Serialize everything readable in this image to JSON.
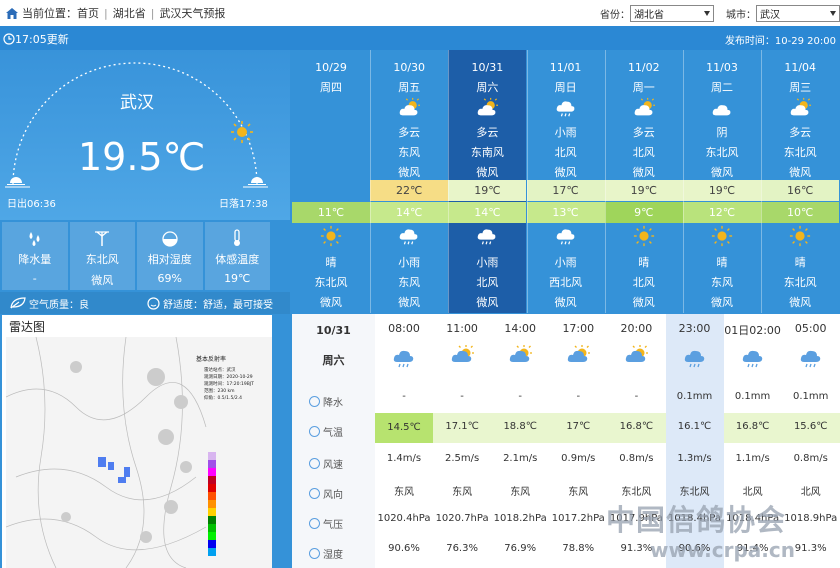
{
  "breadcrumb": {
    "label": "当前位置：",
    "items": [
      "首页",
      "湖北省",
      "武汉天气预报"
    ]
  },
  "selectors": {
    "province_label": "省份：",
    "province_value": "湖北省",
    "city_label": "城市：",
    "city_value": "武汉"
  },
  "update_text": "17:05更新",
  "publish_time": "发布时间：10-29 20:00",
  "current": {
    "city": "武汉",
    "temp": "19.5℃",
    "sunrise": "日出06:36",
    "sunset": "日落17:38"
  },
  "stats": [
    {
      "icon": "rain-drops-icon",
      "label": "降水量",
      "value": "-"
    },
    {
      "icon": "wind-turbine-icon",
      "label": "东北风",
      "value": "微风"
    },
    {
      "icon": "humidity-icon",
      "label": "相对湿度",
      "value": "69%"
    },
    {
      "icon": "thermometer-icon",
      "label": "体感温度",
      "value": "19℃"
    }
  ],
  "air": {
    "quality": "空气质量：良",
    "comfort": "舒适度：舒适，最可接受"
  },
  "radar": {
    "title": "雷达图",
    "header": "基本反射率",
    "station": "雷达站点：武汉",
    "obs_time": "观测日期：2020-10-29",
    "scan_time": "观测时间：17:20:19BJT",
    "range": "范围：230 km",
    "elev": "仰角：0.5/1.5/2.4"
  },
  "days": [
    {
      "date": "10/29",
      "week": "周四",
      "day_icon": "",
      "day_cond": "",
      "day_wind": "",
      "day_level": "",
      "hi": "",
      "lo": "11℃",
      "night_icon": "sun-icon",
      "night_cond": "晴",
      "night_wind": "东北风",
      "night_level": "微风",
      "hi_color": "",
      "lo_color": "#a8d86a"
    },
    {
      "date": "10/30",
      "week": "周五",
      "day_icon": "partly-cloudy-icon",
      "day_cond": "多云",
      "day_wind": "东风",
      "day_level": "微风",
      "hi": "22℃",
      "lo": "14℃",
      "night_icon": "cloud-rain-icon",
      "night_cond": "小雨",
      "night_wind": "东风",
      "night_level": "微风",
      "hi_color": "#f6dd86",
      "lo_color": "#c6e98c"
    },
    {
      "date": "10/31",
      "week": "周六",
      "day_icon": "partly-cloudy-icon",
      "day_cond": "多云",
      "day_wind": "东南风",
      "day_level": "微风",
      "hi": "19℃",
      "lo": "14℃",
      "night_icon": "cloud-rain-icon",
      "night_cond": "小雨",
      "night_wind": "北风",
      "night_level": "微风",
      "hi_color": "#e8f5c9",
      "lo_color": "#c6e98c"
    },
    {
      "date": "11/01",
      "week": "周日",
      "day_icon": "cloud-rain-icon",
      "day_cond": "小雨",
      "day_wind": "北风",
      "day_level": "微风",
      "hi": "17℃",
      "lo": "13℃",
      "night_icon": "cloud-rain-icon",
      "night_cond": "小雨",
      "night_wind": "西北风",
      "night_level": "微风",
      "hi_color": "#e3f3c4",
      "lo_color": "#c6e98c"
    },
    {
      "date": "11/02",
      "week": "周一",
      "day_icon": "partly-cloudy-icon",
      "day_cond": "多云",
      "day_wind": "北风",
      "day_level": "微风",
      "hi": "19℃",
      "lo": "9℃",
      "night_icon": "sun-icon",
      "night_cond": "晴",
      "night_wind": "北风",
      "night_level": "微风",
      "hi_color": "#e8f5c9",
      "lo_color": "#9fd55b"
    },
    {
      "date": "11/03",
      "week": "周二",
      "day_icon": "cloud-icon",
      "day_cond": "阴",
      "day_wind": "东北风",
      "day_level": "微风",
      "hi": "19℃",
      "lo": "12℃",
      "night_icon": "sun-icon",
      "night_cond": "晴",
      "night_wind": "东风",
      "night_level": "微风",
      "hi_color": "#e8f5c9",
      "lo_color": "#b9e37c"
    },
    {
      "date": "11/04",
      "week": "周三",
      "day_icon": "partly-cloudy-icon",
      "day_cond": "多云",
      "day_wind": "东北风",
      "day_level": "微风",
      "hi": "16℃",
      "lo": "10℃",
      "night_icon": "sun-icon",
      "night_cond": "晴",
      "night_wind": "东北风",
      "night_level": "微风",
      "hi_color": "#e3f3c4",
      "lo_color": "#a8d86a"
    }
  ],
  "hourly": {
    "date": "10/31",
    "week": "周六",
    "labels": [
      {
        "icon": "precip-icon",
        "text": "降水"
      },
      {
        "icon": "thermometer-icon",
        "text": "气温"
      },
      {
        "icon": "wind-speed-icon",
        "text": "风速"
      },
      {
        "icon": "wind-direction-icon",
        "text": "风向"
      },
      {
        "icon": "pressure-icon",
        "text": "气压"
      },
      {
        "icon": "humidity-icon",
        "text": "湿度"
      }
    ],
    "cols": [
      {
        "time": "08:00",
        "icon": "cloud-rain-icon",
        "rain": "-",
        "temp": "14.5℃",
        "speed": "1.4m/s",
        "dir": "东风",
        "pres": "1020.4hPa",
        "hum": "90.6%",
        "temp_hl": true
      },
      {
        "time": "11:00",
        "icon": "partly-cloudy-icon",
        "rain": "-",
        "temp": "17.1℃",
        "speed": "2.5m/s",
        "dir": "东风",
        "pres": "1020.7hPa",
        "hum": "76.3%",
        "temp_hl": false
      },
      {
        "time": "14:00",
        "icon": "partly-cloudy-icon",
        "rain": "-",
        "temp": "18.8℃",
        "speed": "2.1m/s",
        "dir": "东风",
        "pres": "1018.2hPa",
        "hum": "76.9%",
        "temp_hl": false
      },
      {
        "time": "17:00",
        "icon": "partly-cloudy-icon",
        "rain": "-",
        "temp": "17℃",
        "speed": "0.9m/s",
        "dir": "东风",
        "pres": "1017.2hPa",
        "hum": "78.8%",
        "temp_hl": false
      },
      {
        "time": "20:00",
        "icon": "partly-cloudy-icon",
        "rain": "-",
        "temp": "16.8℃",
        "speed": "0.8m/s",
        "dir": "东北风",
        "pres": "1017.9hPa",
        "hum": "91.3%",
        "temp_hl": false
      },
      {
        "time": "23:00",
        "icon": "cloud-rain-icon",
        "rain": "0.1mm",
        "temp": "16.1℃",
        "speed": "1.3m/s",
        "dir": "东北风",
        "pres": "1018.4hPa",
        "hum": "90.6%",
        "temp_hl": false
      },
      {
        "time": "01日02:00",
        "icon": "cloud-rain-icon",
        "rain": "0.1mm",
        "temp": "16.8℃",
        "speed": "1.1m/s",
        "dir": "北风",
        "pres": "1018.4hPa",
        "hum": "91.4%",
        "temp_hl": false
      },
      {
        "time": "05:00",
        "icon": "cloud-rain-icon",
        "rain": "0.1mm",
        "temp": "15.6℃",
        "speed": "0.8m/s",
        "dir": "北风",
        "pres": "1018.9hPa",
        "hum": "91.3%",
        "temp_hl": false
      }
    ]
  },
  "watermark": {
    "line1": "中国信鸽协会",
    "line2": "www.crpa.cn"
  },
  "colors": {
    "bg": "#3592d8",
    "selected_day": "#1d5ea8",
    "accent_sun": "#f2b51c"
  }
}
